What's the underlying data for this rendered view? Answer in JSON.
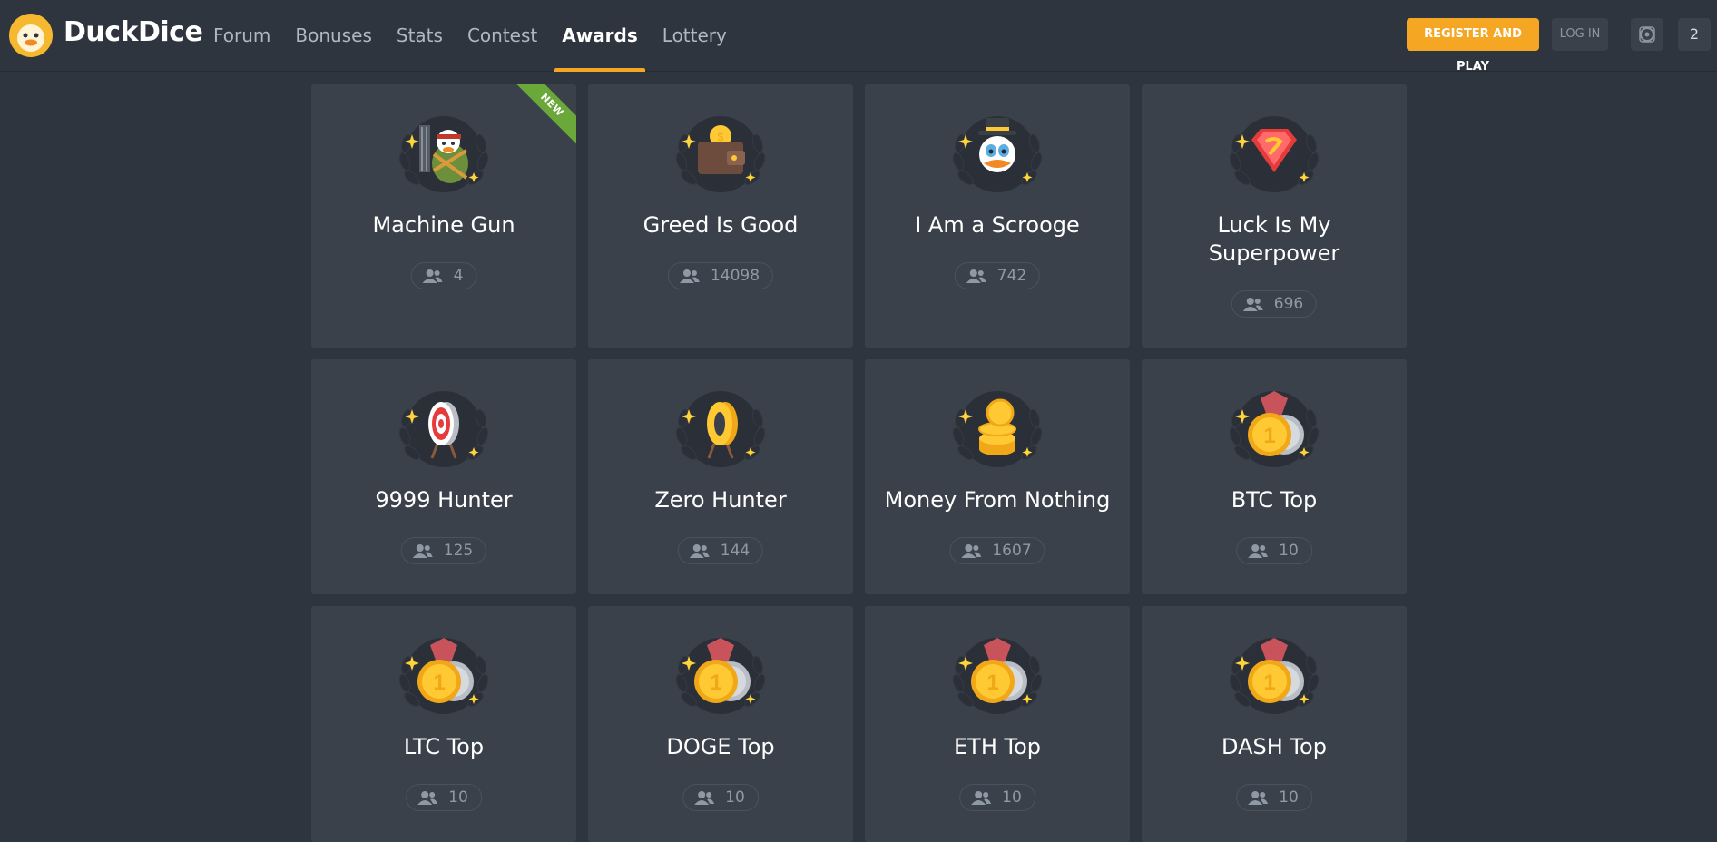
{
  "brand": {
    "name": "DuckDice"
  },
  "nav": [
    {
      "label": "Forum",
      "active": false
    },
    {
      "label": "Bonuses",
      "active": false
    },
    {
      "label": "Stats",
      "active": false
    },
    {
      "label": "Contest",
      "active": false
    },
    {
      "label": "Awards",
      "active": true
    },
    {
      "label": "Lottery",
      "active": false
    }
  ],
  "header_actions": {
    "register_label": "REGISTER AND PLAY",
    "login_label": "LOG IN",
    "count_label": "2"
  },
  "colors": {
    "accent": "#f5a623",
    "ribbon": "#6aa83a",
    "background": "#2f353e",
    "card": "#3a414b"
  },
  "awards": [
    {
      "title": "Machine Gun",
      "count": "4",
      "icon": "machine-gun-duck-icon",
      "ribbon": "NEW"
    },
    {
      "title": "Greed Is Good",
      "count": "14098",
      "icon": "wallet-icon"
    },
    {
      "title": "I Am a Scrooge",
      "count": "742",
      "icon": "scrooge-duck-icon"
    },
    {
      "title": "Luck Is My Superpower",
      "count": "696",
      "icon": "superhero-emblem-icon"
    },
    {
      "title": "9999 Hunter",
      "count": "125",
      "icon": "target-icon"
    },
    {
      "title": "Zero Hunter",
      "count": "144",
      "icon": "zero-coin-icon"
    },
    {
      "title": "Money From Nothing",
      "count": "1607",
      "icon": "coin-stack-icon"
    },
    {
      "title": "BTC Top",
      "count": "10",
      "icon": "first-place-medal-icon"
    },
    {
      "title": "LTC Top",
      "count": "10",
      "icon": "first-place-medal-icon"
    },
    {
      "title": "DOGE Top",
      "count": "10",
      "icon": "first-place-medal-icon"
    },
    {
      "title": "ETH Top",
      "count": "10",
      "icon": "first-place-medal-icon"
    },
    {
      "title": "DASH Top",
      "count": "10",
      "icon": "first-place-medal-icon"
    }
  ]
}
